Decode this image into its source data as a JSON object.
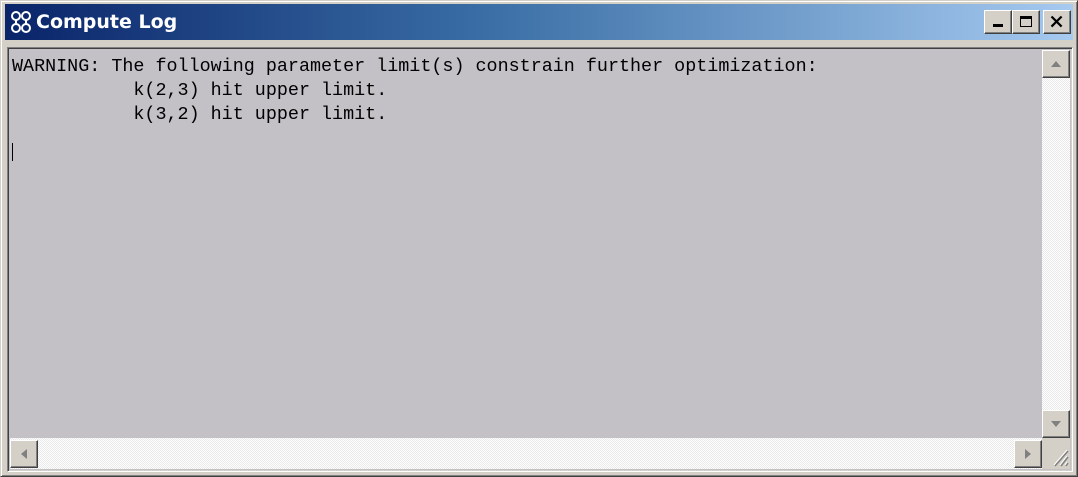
{
  "window": {
    "title": "Compute Log",
    "icon": "compute-log-app-icon",
    "caption_buttons": [
      "minimize-icon",
      "maximize-icon",
      "close-icon"
    ]
  },
  "log": {
    "lines": [
      "WARNING: The following parameter limit(s) constrain further optimization:",
      "           k(2,3) hit upper limit.",
      "           k(3,2) hit upper limit."
    ]
  },
  "colors": {
    "title_gradient_start": "#0a246a",
    "title_gradient_end": "#a6caf0",
    "log_background": "#c4c1c6",
    "chrome": "#d4d0c8"
  },
  "scrollbars": {
    "vertical_icons": [
      "arrow-up-icon",
      "arrow-down-icon"
    ],
    "horizontal_icons": [
      "arrow-left-icon",
      "arrow-right-icon"
    ]
  }
}
